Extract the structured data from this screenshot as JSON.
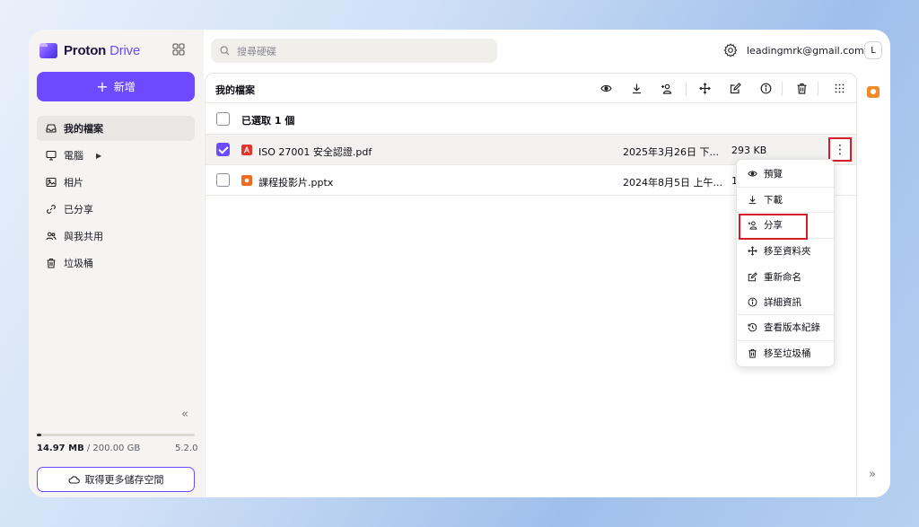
{
  "app": {
    "logo_primary": "Proton",
    "logo_secondary": "Drive"
  },
  "sidebar": {
    "new_button_label": "新增",
    "items": [
      {
        "label": "我的檔案",
        "icon": "inbox-icon",
        "active": true
      },
      {
        "label": "電腦",
        "icon": "monitor-icon",
        "has_caret": true
      },
      {
        "label": "相片",
        "icon": "image-icon"
      },
      {
        "label": "已分享",
        "icon": "link-icon"
      },
      {
        "label": "與我共用",
        "icon": "users-icon"
      },
      {
        "label": "垃圾桶",
        "icon": "trash-icon"
      }
    ],
    "collapse_label": "«",
    "storage_used": "14.97 MB",
    "storage_total": "/ 200.00 GB",
    "storage_fraction": 0.03,
    "version": "5.2.0",
    "more_storage_label": "取得更多儲存空間"
  },
  "header": {
    "search_placeholder": "搜尋硬碟",
    "email": "leadingmrk@gmail.com",
    "avatar_initial": "L"
  },
  "main": {
    "breadcrumb": "我的檔案",
    "toolbar_icons": [
      "eye-icon",
      "download-icon",
      "share-user-icon",
      "move-icon",
      "edit-icon",
      "info-icon",
      "trash-icon",
      "grid-icon"
    ],
    "selection_label": "已選取 1 個",
    "files": [
      {
        "name": "ISO 27001 安全認證.pdf",
        "date": "2025年3月26日 下...",
        "size": "293 KB",
        "type": "pdf",
        "color": "#e6332a",
        "selected": true
      },
      {
        "name": "課程投影片.pptx",
        "date": "2024年8月5日 上午...",
        "size": "1...",
        "type": "pptx",
        "color": "#f06a1f",
        "selected": false
      }
    ],
    "kebab_label": "⋮"
  },
  "context_menu": {
    "items": [
      {
        "label": "預覽",
        "icon": "eye-icon"
      },
      {
        "label": "下載",
        "icon": "download-icon"
      },
      {
        "label": "分享",
        "icon": "share-user-icon"
      },
      {
        "label": "移至資料夾",
        "icon": "move-icon"
      },
      {
        "label": "重新命名",
        "icon": "edit-icon"
      },
      {
        "label": "詳細資訊",
        "icon": "info-icon"
      },
      {
        "label": "查看版本紀錄",
        "icon": "history-icon"
      },
      {
        "label": "移至垃圾桶",
        "icon": "trash-icon"
      }
    ]
  },
  "rail": {
    "expand_label": "»"
  },
  "colors": {
    "accent": "#6d4aff",
    "highlight": "#d41c2a"
  }
}
